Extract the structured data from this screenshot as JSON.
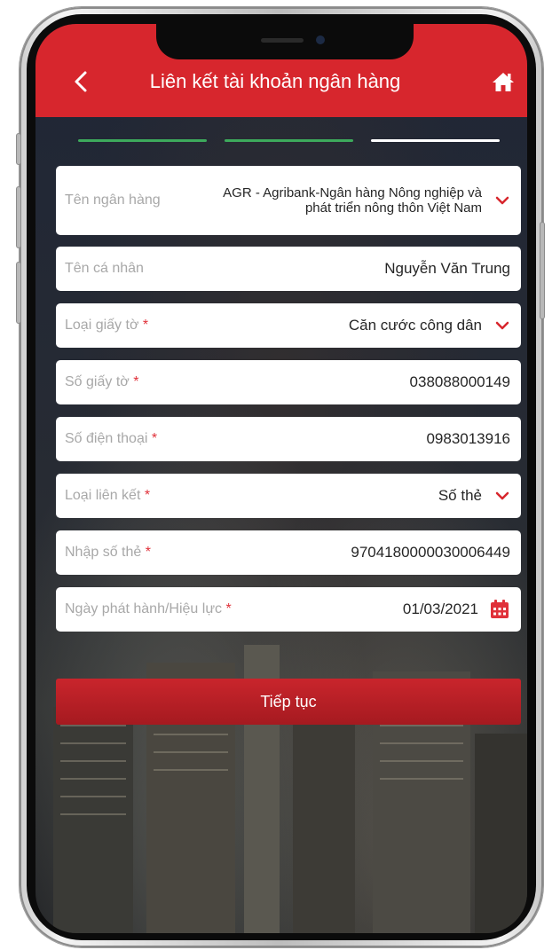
{
  "header": {
    "title": "Liên kết tài khoản ngân hàng",
    "back_icon": "chevron-left-icon",
    "home_icon": "home-icon"
  },
  "progress": {
    "total_steps": 3,
    "completed_steps": 2,
    "colors": {
      "done": "#3daa5c",
      "pending": "#ffffff"
    }
  },
  "form": {
    "bank": {
      "label": "Tên ngân hàng",
      "value": "AGR - Agribank-Ngân hàng Nông nghiệp và phát triển nông thôn Việt Nam"
    },
    "personal_name": {
      "label": "Tên cá nhân",
      "value": "Nguyễn Văn Trung"
    },
    "document_type": {
      "label": "Loại giấy tờ",
      "required_mark": "*",
      "value": "Căn cước công dân"
    },
    "document_number": {
      "label": "Số giấy tờ",
      "required_mark": "*",
      "value": "038088000149"
    },
    "phone_number": {
      "label": "Số điện thoại",
      "required_mark": "*",
      "value": "0983013916"
    },
    "link_type": {
      "label": "Loại liên kết",
      "required_mark": "*",
      "value": "Số thẻ"
    },
    "card_number": {
      "label": "Nhập số thẻ",
      "required_mark": "*",
      "value": "9704180000030006449"
    },
    "issue_date": {
      "label": "Ngày phát hành/Hiệu lực",
      "required_mark": "*",
      "value": "01/03/2021"
    }
  },
  "actions": {
    "continue_label": "Tiếp tục"
  },
  "colors": {
    "brand_red": "#d7262d",
    "button_red": "#b31d23",
    "required_red": "#e0313a"
  }
}
